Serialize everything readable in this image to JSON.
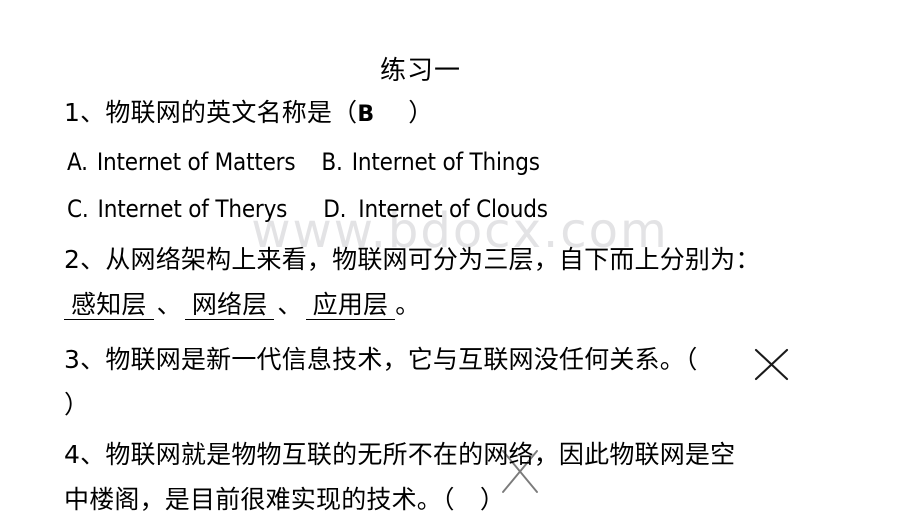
{
  "document": {
    "title": "练习一",
    "watermark": "www.bdocx.com",
    "background_color": "#ffffff",
    "text_color": "#000000",
    "watermark_color": "#e3e3e5"
  },
  "questions": [
    {
      "number": "1、",
      "stem": "物联网的英文名称是（",
      "answer": "B",
      "stem_close": "）",
      "options": [
        {
          "label": "A.",
          "text": "Internet of Matters"
        },
        {
          "label": "B.",
          "text": "Internet of Things"
        },
        {
          "label": "C.",
          "text": "Internet of Therys"
        },
        {
          "label": "D.",
          "text": "Internet of Clouds"
        }
      ]
    },
    {
      "number": "2、",
      "stem": "从网络架构上来看，物联网可分为三层，自下而上分别为：",
      "blanks": [
        "感知层",
        "网络层",
        "应用层"
      ],
      "blank_separator": "、",
      "trailing": "。"
    },
    {
      "number": "3、",
      "line1": "物联网是新一代信息技术，它与互联网没任何关系。（",
      "mark": "╳",
      "line2": "）"
    },
    {
      "number": "4、",
      "line1": "物联网就是物物互联的无所不在的网络，因此物联网是空",
      "line2": "中楼阁，是目前很难实现的技术。（　）",
      "mark": "╳"
    }
  ]
}
